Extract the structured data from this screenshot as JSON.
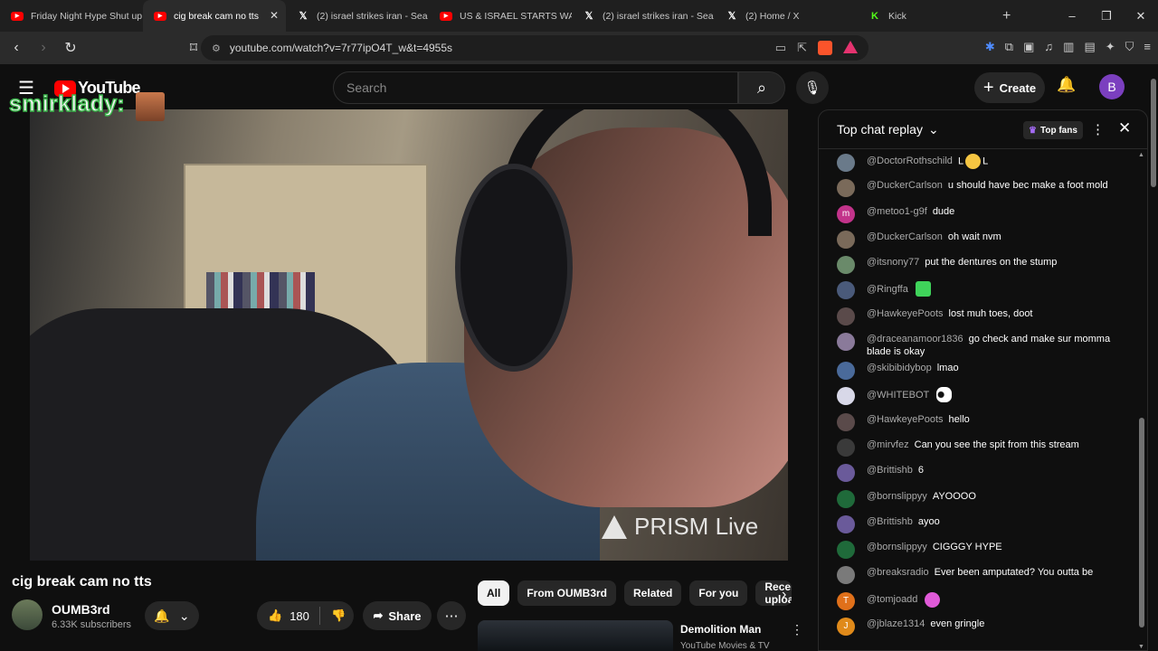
{
  "browser": {
    "tabs": [
      {
        "title": "Friday Night Hype Shut up",
        "icon": "youtube-icon"
      },
      {
        "title": "cig break cam no tts",
        "icon": "youtube-icon"
      },
      {
        "title": "(2) israel strikes iran - Sea",
        "icon": "x-icon"
      },
      {
        "title": "US & ISRAEL STARTS WAR",
        "icon": "youtube-icon"
      },
      {
        "title": "(2) israel strikes iran - Sea",
        "icon": "x-icon"
      },
      {
        "title": "(2) Home / X",
        "icon": "x-icon"
      },
      {
        "title": "Kick",
        "icon": "kick-icon"
      }
    ],
    "url": "youtube.com/watch?v=7r77ipO4T_w&t=4955s"
  },
  "header": {
    "logo_text": "YouTube",
    "search_placeholder": "Search",
    "create_label": "Create",
    "avatar_letter": "B"
  },
  "overlay": {
    "name": "smirklady:"
  },
  "video": {
    "watermark": "PRISM Live",
    "title": "cig break cam no tts"
  },
  "channel": {
    "name": "OUMB3rd",
    "subscribers": "6.33K subscribers"
  },
  "actions": {
    "likes": "180",
    "share_label": "Share"
  },
  "chips": [
    "All",
    "From OUMB3rd",
    "Related",
    "For you",
    "Recently uploaded"
  ],
  "related": {
    "title": "Demolition Man",
    "subtitle": "YouTube Movies & TV"
  },
  "chat": {
    "mode": "Top chat replay",
    "top_fans_label": "Top fans",
    "messages": [
      {
        "author": "@DoctorRothschild",
        "text": "L",
        "suffix": "L",
        "emote": "laughing-emoji",
        "avatar_color": "#6a7a8a"
      },
      {
        "author": "@DuckerCarlson",
        "text": "u should have bec make a foot mold",
        "avatar_color": "#7a6a5a"
      },
      {
        "author": "@metoo1-g9f",
        "text": "dude",
        "avatar_color": "#c2338a",
        "letter": "m"
      },
      {
        "author": "@DuckerCarlson",
        "text": "oh wait nvm",
        "avatar_color": "#7a6a5a"
      },
      {
        "author": "@itsnony77",
        "text": "put the dentures on the stump",
        "avatar_color": "#6a8a6a"
      },
      {
        "author": "@Ringffa",
        "text": "",
        "emote": "green-face-emote",
        "avatar_color": "#4a5a7a"
      },
      {
        "author": "@HawkeyePoots",
        "text": "lost muh toes, doot",
        "avatar_color": "#5a4a4a"
      },
      {
        "author": "@draceanamoor1836",
        "text": "go check and make sur momma blade is okay",
        "avatar_color": "#8a7a9a"
      },
      {
        "author": "@skibibidybop",
        "text": "lmao",
        "avatar_color": "#4a6a9a"
      },
      {
        "author": "@WHITEBOT",
        "text": "",
        "emote": "eyes-emoji",
        "avatar_color": "#d8d8e8"
      },
      {
        "author": "@HawkeyePoots",
        "text": "hello",
        "avatar_color": "#5a4a4a"
      },
      {
        "author": "@mirvfez",
        "text": "Can you see the spit from this stream",
        "avatar_color": "#3a3a3a"
      },
      {
        "author": "@Brittishb",
        "text": "6",
        "avatar_color": "#6a5a9a"
      },
      {
        "author": "@bornslippyy",
        "text": "AYOOOO",
        "avatar_color": "#1f6a3a"
      },
      {
        "author": "@Brittishb",
        "text": "ayoo",
        "avatar_color": "#6a5a9a"
      },
      {
        "author": "@bornslippyy",
        "text": "CIGGGY HYPE",
        "avatar_color": "#1f6a3a"
      },
      {
        "author": "@breaksradio",
        "text": "Ever been amputated? You outta be",
        "avatar_color": "#7a7a7a"
      },
      {
        "author": "@tomjoadd",
        "text": "",
        "emote": "pink-face-emote",
        "avatar_color": "#e0701a",
        "letter": "T"
      },
      {
        "author": "@jblaze1314",
        "text": "even gringle",
        "avatar_color": "#e08a1a",
        "letter": "J"
      }
    ]
  }
}
